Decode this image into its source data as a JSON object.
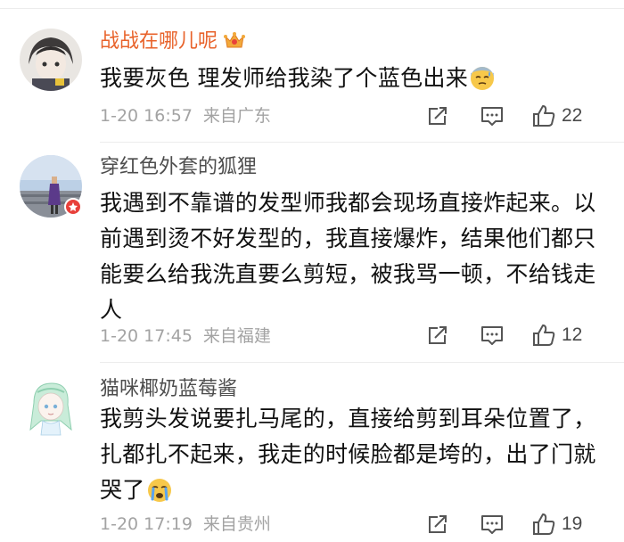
{
  "comments": [
    {
      "username": "战战在哪儿呢",
      "text": "我要灰色  理发师给我染了个蓝色出来",
      "date": "1-20 16:57",
      "location": "来自广东",
      "likes": "22",
      "badge_icon": "crown-badge-icon",
      "trailing_emoji": "cold-sweat-emoji-icon"
    },
    {
      "username": "穿红色外套的狐狸",
      "text": "我遇到不靠谱的发型师我都会现场直接炸起来。以前遇到烫不好发型的，我直接爆炸，结果他们都只能要么给我洗直要么剪短，被我骂一顿，不给钱走人",
      "date": "1-20 17:45",
      "location": "来自福建",
      "likes": "12"
    },
    {
      "username": "猫咪椰奶蓝莓酱",
      "text": "我剪头发说要扎马尾的，直接给剪到耳朵位置了，扎都扎不起来，我走的时候脸都是垮的，出了门就哭了",
      "date": "1-20 17:19",
      "location": "来自贵州",
      "likes": "19",
      "trailing_emoji": "crying-emoji-icon"
    }
  ],
  "colors": {
    "vip_name": "#e8622a",
    "normal_name": "#4d4d4d",
    "meta_text": "#a3a3a3",
    "icon_stroke": "#555555",
    "badge_red": "#e8403a"
  }
}
